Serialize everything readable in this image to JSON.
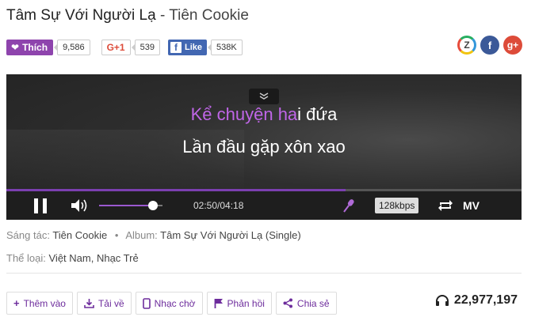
{
  "song": {
    "title": "Tâm Sự Với Người Lạ",
    "artist_sep": " - ",
    "artist": "Tiên Cookie"
  },
  "social": {
    "like_label": "Thích",
    "like_count": "9,586",
    "gplus_label": "G+1",
    "gplus_count": "539",
    "fb_like_label": "Like",
    "fb_like_count": "538K",
    "share_icons": [
      "zing-me-icon",
      "facebook-icon",
      "google-plus-icon"
    ]
  },
  "player": {
    "lyric_line1_highlight": "Kể chuyện ha",
    "lyric_line1_rest": "i đứa",
    "lyric_line2": "Lần đầu gặp xôn xao",
    "current_time": "02:50",
    "duration": "04:18",
    "time_display": "02:50/04:18",
    "progress_fraction": 0.659,
    "volume_fraction": 0.85,
    "bitrate": "128kbps",
    "mv_label": "MV",
    "lyric_highlight_color": "#c066e8",
    "accent_color": "#7b3fb0"
  },
  "meta": {
    "composer_label": "Sáng tác:",
    "composer": "Tiên Cookie",
    "album_label": "Album:",
    "album": "Tâm Sự Với Người Lạ (Single)",
    "genre_label": "Thể loại:",
    "genre": "Việt Nam, Nhạc Trẻ"
  },
  "actions": {
    "add": "Thêm vào",
    "download": "Tải về",
    "ringtone": "Nhạc chờ",
    "feedback": "Phản hồi",
    "share": "Chia sẻ"
  },
  "stats": {
    "listen_count": "22,977,197"
  }
}
